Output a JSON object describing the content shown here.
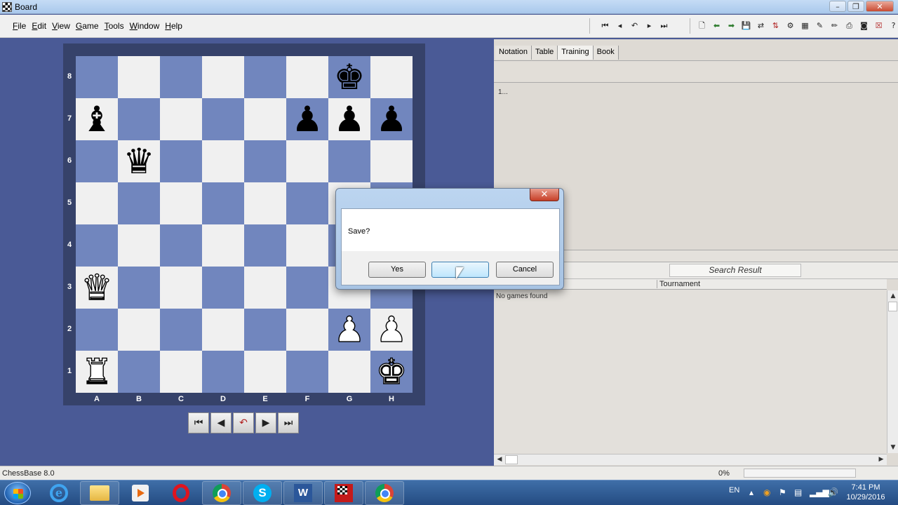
{
  "window": {
    "title": "Board"
  },
  "menu": [
    "File",
    "Edit",
    "View",
    "Game",
    "Tools",
    "Window",
    "Help"
  ],
  "board": {
    "ranks": [
      "8",
      "7",
      "6",
      "5",
      "4",
      "3",
      "2",
      "1"
    ],
    "files": [
      "A",
      "B",
      "C",
      "D",
      "E",
      "F",
      "G",
      "H"
    ],
    "light_color": "#f0f0f0",
    "dark_color": "#7186be",
    "pieces": [
      {
        "square": "g8",
        "glyph": "♚",
        "color": "black",
        "name": "black-king"
      },
      {
        "square": "a7",
        "glyph": "♝",
        "color": "black",
        "name": "black-bishop"
      },
      {
        "square": "f7",
        "glyph": "♟",
        "color": "black",
        "name": "black-pawn"
      },
      {
        "square": "g7",
        "glyph": "♟",
        "color": "black",
        "name": "black-pawn"
      },
      {
        "square": "h7",
        "glyph": "♟",
        "color": "black",
        "name": "black-pawn"
      },
      {
        "square": "b6",
        "glyph": "♛",
        "color": "black",
        "name": "black-queen"
      },
      {
        "square": "a3",
        "glyph": "♛",
        "color": "white",
        "name": "white-queen"
      },
      {
        "square": "g2",
        "glyph": "♟",
        "color": "white",
        "name": "white-pawn"
      },
      {
        "square": "h2",
        "glyph": "♟",
        "color": "white",
        "name": "white-pawn"
      },
      {
        "square": "a1",
        "glyph": "♜",
        "color": "white",
        "name": "white-rook"
      },
      {
        "square": "h1",
        "glyph": "♚",
        "color": "white",
        "name": "white-king"
      }
    ]
  },
  "nav_buttons": [
    {
      "name": "first-move-button",
      "glyph": "⏮"
    },
    {
      "name": "prev-move-button",
      "glyph": "◀"
    },
    {
      "name": "take-back-button",
      "glyph": "↶"
    },
    {
      "name": "next-move-button",
      "glyph": "▶"
    },
    {
      "name": "last-move-button",
      "glyph": "⏭"
    }
  ],
  "tabs": [
    "Notation",
    "Table",
    "Training",
    "Book"
  ],
  "active_tab": "Training",
  "notation_text": "1...",
  "search": {
    "button_label": "Search Result"
  },
  "columns": {
    "tournament": "Tournament"
  },
  "games": {
    "empty_text": "No games found"
  },
  "statusbar": {
    "left": "ChessBase 8.0",
    "progress_text": "0%",
    "progress": 0
  },
  "dialog": {
    "message": "Save?",
    "yes": "Yes",
    "no": "",
    "cancel": "Cancel",
    "close_glyph": "✕"
  },
  "taskbar": {
    "language": "EN",
    "time": "7:41 PM",
    "date": "10/29/2016"
  }
}
